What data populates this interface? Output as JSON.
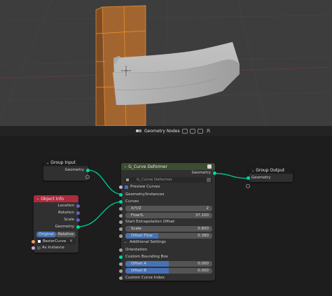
{
  "editor": {
    "title": "Geometry Nodes"
  },
  "group_input": {
    "title": "Group Input",
    "geometry": "Geometry"
  },
  "object_info": {
    "title": "Object Info",
    "location": "Location",
    "rotation": "Rotation",
    "scale": "Scale",
    "geometry": "Geometry",
    "original": "Original",
    "relative": "Relative",
    "object": "BezierCurve",
    "as_instance": "As Instance"
  },
  "deformer": {
    "title": "G_Curve Deformer",
    "geometry_out": "Geometry",
    "group_name": "G_Curve Deformer",
    "preview_curves": "Preview Curves",
    "geometry_instances": "Geometry/Instances",
    "curves": "Curves",
    "axis_label": "X/Y/Z",
    "axis_value": "2",
    "flow_label": "Flow%",
    "flow_value": "37.100",
    "start_extrapolation": "Start Extrapolation Offset",
    "scale_label": "Scale",
    "scale_value": "0.800",
    "offset_flow_label": "Offset Flow",
    "offset_flow_value": "0.380",
    "additional_settings": "Additional Settings",
    "orientation": "Orientation",
    "custom_bbox": "Custom Bounding Box",
    "offset_a_label": "Offset A",
    "offset_a_value": "0.000",
    "offset_b_label": "Offset B",
    "offset_b_value": "0.000",
    "custom_curve_index": "Custom Curve Index"
  },
  "group_output": {
    "title": "Group Output",
    "geometry": "Geometry"
  },
  "colors": {
    "geometry_socket": "#00d6a3",
    "vector_socket": "#6363c7",
    "object_header": "#ad2b3f",
    "group_header": "#3c4d32",
    "io_header": "#1d1d1d",
    "selected_object": "#ef8f2e"
  }
}
